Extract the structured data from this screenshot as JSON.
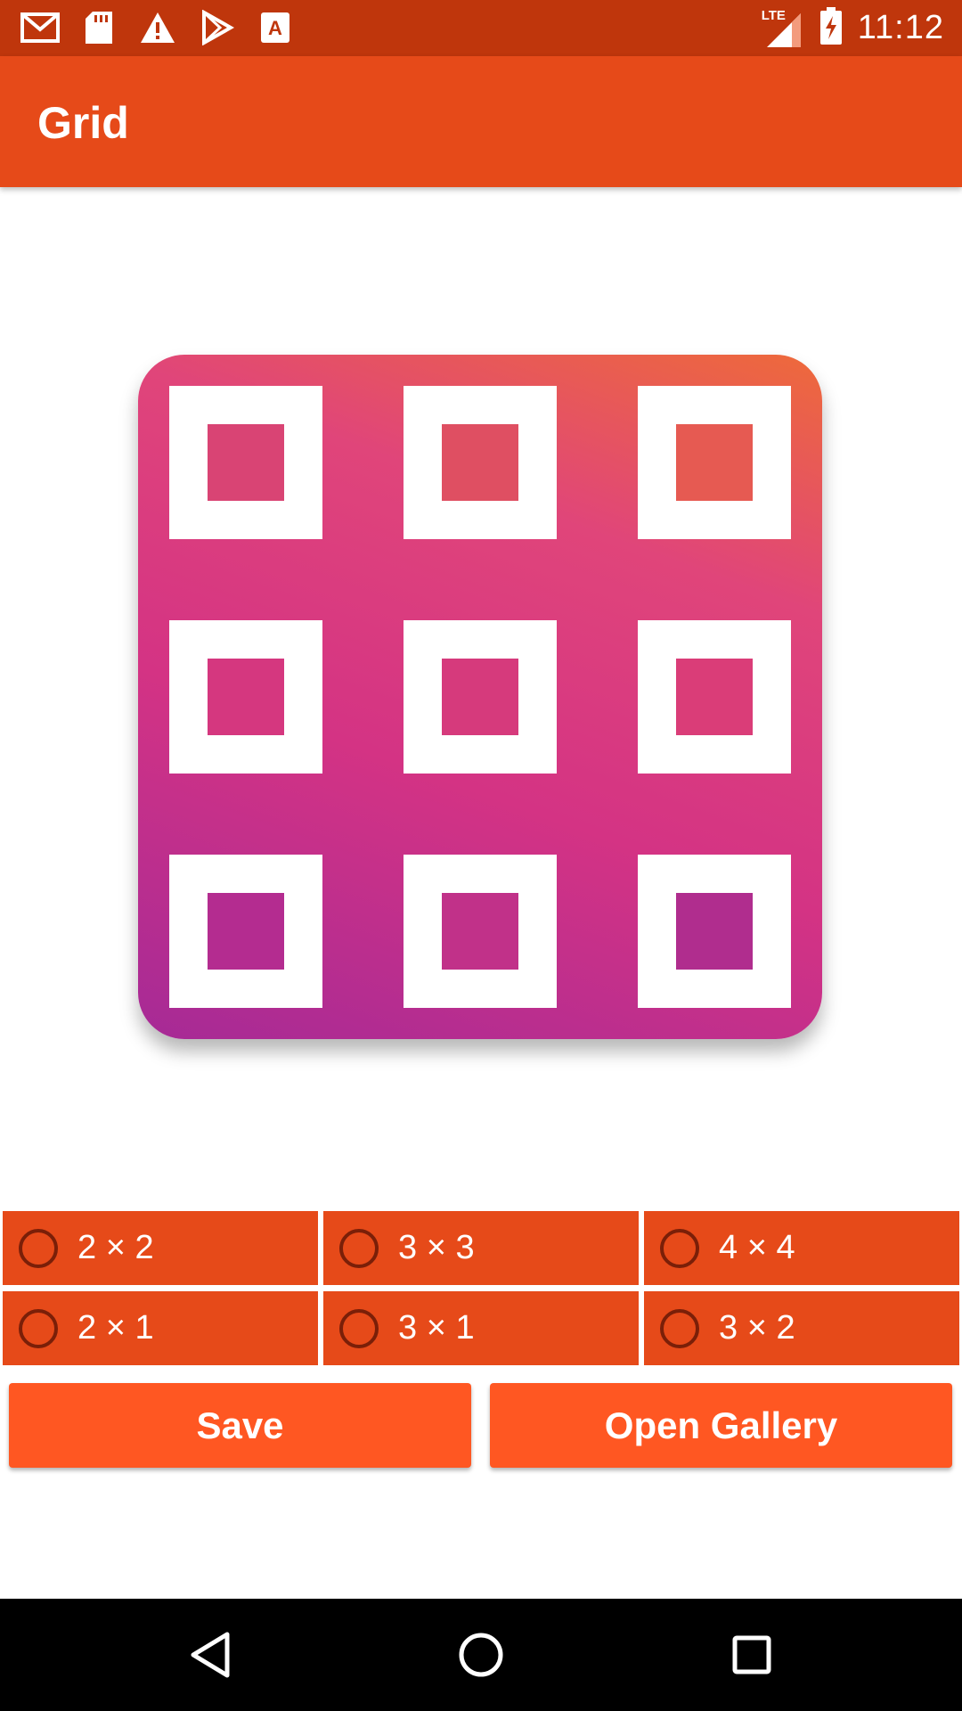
{
  "status_bar": {
    "time": "11:12",
    "network": "LTE",
    "left_icons": [
      "gmail-icon",
      "sd-card-icon",
      "warning-icon",
      "play-store-icon",
      "font-icon"
    ],
    "right_icons": [
      "lte-signal-icon",
      "battery-charging-icon"
    ]
  },
  "app_bar": {
    "title": "Grid"
  },
  "preview": {
    "grid_rows": 3,
    "grid_cols": 3,
    "description_icon": "grid-preview-image"
  },
  "options": [
    {
      "label": "2 × 2",
      "selected": false
    },
    {
      "label": "3 × 3",
      "selected": false
    },
    {
      "label": "4 × 4",
      "selected": false
    },
    {
      "label": "2 × 1",
      "selected": false
    },
    {
      "label": "3 × 1",
      "selected": false
    },
    {
      "label": "3 × 2",
      "selected": false
    }
  ],
  "buttons": {
    "save": "Save",
    "open_gallery": "Open Gallery"
  },
  "colors": {
    "status_bar": "#bf360c",
    "app_bar": "#e64a19",
    "option_bg": "#e64a19",
    "button_bg": "#ff5722",
    "nav_bar": "#000000"
  },
  "nav_bar": {
    "icons": [
      "back-icon",
      "home-icon",
      "recents-icon"
    ]
  }
}
